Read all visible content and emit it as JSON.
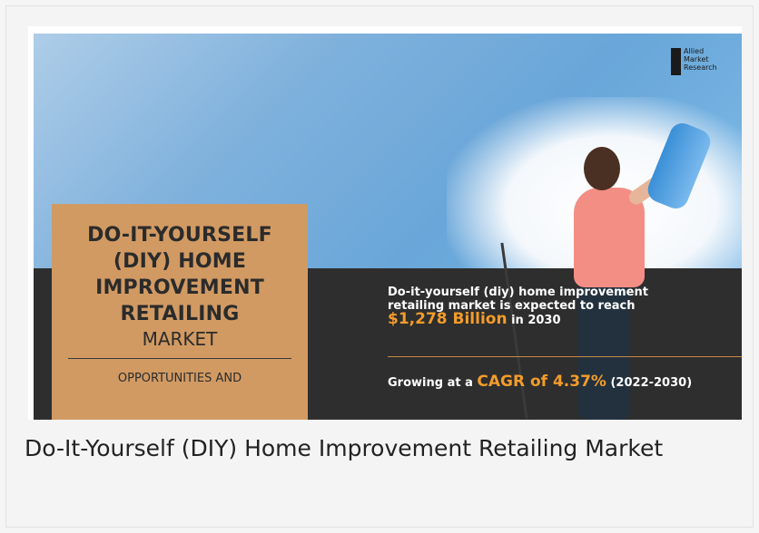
{
  "banner": {
    "logo": {
      "line1": "Allied",
      "line2": "Market",
      "line3": "Research"
    },
    "title_main": "DO-IT-YOURSELF (DIY) HOME IMPROVEMENT RETAILING",
    "title_sub": "MARKET",
    "title_footer": "OPPORTUNITIES AND",
    "stat_line1": "Do-it-yourself (diy) home improvement",
    "stat_line2": "retailing market is expected to reach",
    "stat_value": "$1,278 Billion",
    "stat_suffix": " in 2030",
    "growth_prefix": "Growing at a ",
    "growth_value": "CAGR of 4.37%",
    "growth_suffix": " (2022-2030)",
    "colors": {
      "accent": "#f39c2b",
      "title_box": "#d19a63",
      "band": "#2e2e2e"
    }
  },
  "caption": "Do-It-Yourself (DIY) Home Improvement Retailing Market"
}
